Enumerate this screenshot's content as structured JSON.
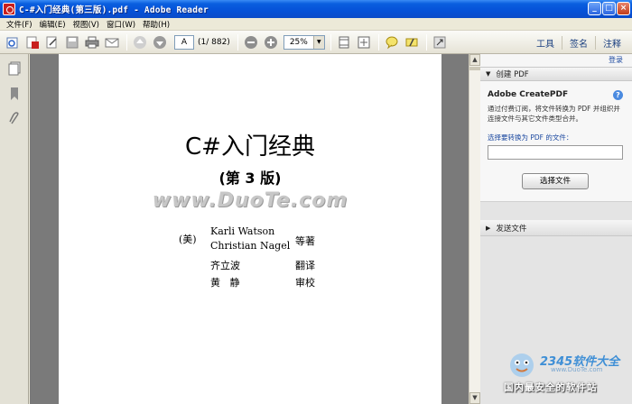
{
  "window": {
    "title": "C-#入门经典(第三版).pdf - Adobe Reader"
  },
  "menu": [
    "文件(F)",
    "编辑(E)",
    "视图(V)",
    "窗口(W)",
    "帮助(H)"
  ],
  "toolbar": {
    "page_value": "A",
    "page_count": "(1/ 882)",
    "zoom_value": "25%",
    "links": [
      "工具",
      "签名",
      "注释"
    ]
  },
  "document": {
    "title": "C#入门经典",
    "edition": "(第 3 版)",
    "watermark": "www.DuoTe.com",
    "country": "(美)",
    "authors": [
      "Karli Watson",
      "Christian Nagel"
    ],
    "author_role": "等著",
    "translator": "齐立波",
    "translator_role": "翻译",
    "reviewer": "黄   静",
    "reviewer_role": "审校"
  },
  "right_pane": {
    "top_link": "登录",
    "create_pdf_header": "创建 PDF",
    "create_pdf_title": "Adobe CreatePDF",
    "create_pdf_desc": "通过付费订阅，将文件转换为 PDF 并组织并连接文件与其它文件类型合并。",
    "select_label": "选择要转换为 PDF 的文件：",
    "choose_button": "选择文件",
    "send_header": "发送文件"
  },
  "watermark_site": {
    "brand": "2345软件大全",
    "url": "www.DuoTe.com",
    "slogan": "国内最安全的软件站"
  },
  "colors": {
    "titlebar": "#0551d8",
    "doc_bg": "#7a7a7a",
    "link": "#1c49a0"
  }
}
